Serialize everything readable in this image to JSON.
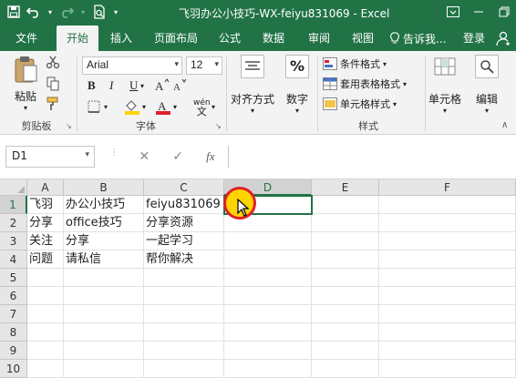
{
  "titlebar": {
    "title": "飞羽办公小技巧-WX-feiyu831069 - Excel",
    "qat_icons": [
      "save-icon",
      "undo-icon",
      "redo-icon",
      "print-preview-icon",
      "customize-icon"
    ],
    "window_icons": [
      "ribbon-display-icon",
      "minimize-icon",
      "restore-icon"
    ]
  },
  "tabs": {
    "items": [
      "文件",
      "开始",
      "插入",
      "页面布局",
      "公式",
      "数据",
      "审阅",
      "视图"
    ],
    "active": "开始",
    "help": "告诉我...",
    "login": "登录"
  },
  "ribbon": {
    "clipboard": {
      "paste": "粘贴",
      "group": "剪贴板"
    },
    "font": {
      "name": "Arial",
      "size": "12",
      "bold": "B",
      "italic": "I",
      "underline": "U",
      "phonetic": "wén",
      "group": "字体"
    },
    "alignment": {
      "label": "对齐方式"
    },
    "number": {
      "label": "数字",
      "symbol": "%"
    },
    "styles": {
      "conditional": "条件格式",
      "table": "套用表格格式",
      "cell_styles": "单元格样式",
      "group": "样式"
    },
    "cells": {
      "label": "单元格"
    },
    "editing": {
      "label": "编辑"
    },
    "colors": {
      "accent": "#217346",
      "fill": "#ffd400",
      "font_color": "#e0202a"
    }
  },
  "formula_bar": {
    "name_box": "D1",
    "fx": "fx",
    "value": ""
  },
  "sheet": {
    "columns": [
      "A",
      "B",
      "C",
      "D",
      "E",
      "F"
    ],
    "rows": [
      "1",
      "2",
      "3",
      "4",
      "5",
      "6",
      "7",
      "8",
      "9",
      "10"
    ],
    "selected_cell": "D1",
    "cells": [
      [
        "飞羽",
        "办公小技巧",
        "feiyu831069",
        "",
        "",
        ""
      ],
      [
        "分享",
        "office技巧",
        "分享资源",
        "",
        "",
        ""
      ],
      [
        "关注",
        "分享",
        "一起学习",
        "",
        "",
        ""
      ],
      [
        "问题",
        "请私信",
        "帮你解决",
        "",
        "",
        ""
      ]
    ]
  }
}
